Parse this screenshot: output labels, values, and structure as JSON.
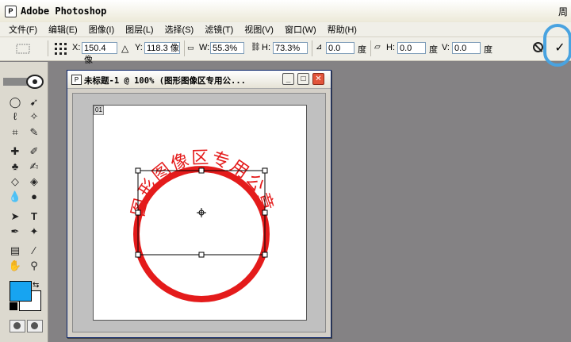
{
  "window": {
    "title": "Adobe Photoshop",
    "icon": "photoshop-app-icon",
    "title_right": "周"
  },
  "menubar": [
    "文件(F)",
    "编辑(E)",
    "图像(I)",
    "图层(L)",
    "选择(S)",
    "滤镜(T)",
    "视图(V)",
    "窗口(W)",
    "帮助(H)"
  ],
  "options": {
    "x_label": "X:",
    "x_value": "150.4 像",
    "y_label": "Y:",
    "y_value": "118.3 像",
    "w_label": "W:",
    "w_value": "55.3%",
    "h_label": "H:",
    "h_value": "73.3%",
    "angle_value": "0.0",
    "angle_unit": "度",
    "hskew_label": "H:",
    "hskew_value": "0.0",
    "hskew_unit": "度",
    "vskew_label": "V:",
    "vskew_value": "0.0",
    "vskew_unit": "度",
    "commit_symbol": "✓"
  },
  "document": {
    "title": "未标题-1 @ 100% (图形图像区专用公...",
    "badge": "01",
    "stamp_text": "图形图像区专用公章",
    "stamp_color": "#e41b1b"
  },
  "swatches": {
    "foreground": "#17a4f1",
    "background": "#ffffff"
  }
}
